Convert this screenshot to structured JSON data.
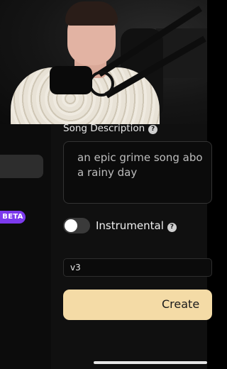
{
  "sidebar": {
    "beta_badge": "BETA"
  },
  "song_description": {
    "label": "Song Description",
    "help_glyph": "?",
    "value": "an epic grime song abo\na rainy day"
  },
  "instrumental": {
    "label": "Instrumental",
    "help_glyph": "?",
    "enabled": false
  },
  "model_select": {
    "value": "v3"
  },
  "create_button": {
    "label": "Create"
  },
  "colors": {
    "accent_button": "#f4dba6",
    "beta_badge": "#7c3aed",
    "background": "#101010"
  }
}
